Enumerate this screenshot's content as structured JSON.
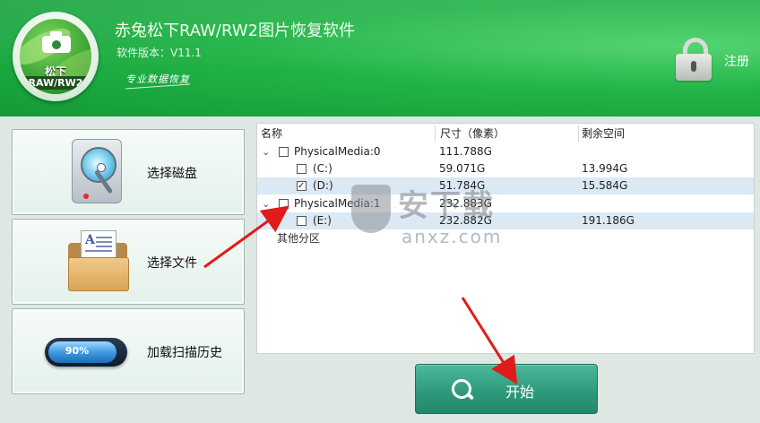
{
  "header": {
    "logo_line1": "松下",
    "logo_line2": "RAW/RW2",
    "title": "赤兔松下RAW/RW2图片恢复软件",
    "version": "软件版本：V11.1",
    "slogan": "专业数据恢复",
    "register_label": "注册"
  },
  "sidebar": {
    "items": [
      {
        "label": "选择磁盘",
        "icon": "disk-icon"
      },
      {
        "label": "选择文件",
        "icon": "folder-icon"
      },
      {
        "label": "加载扫描历史",
        "icon": "progress-icon",
        "progress_text": "90%",
        "progress": 0.9
      }
    ]
  },
  "tree": {
    "columns": [
      "名称",
      "尺寸（像素）",
      "剩余空间"
    ],
    "rows": [
      {
        "name": "PhysicalMedia:0",
        "size": "111.788G",
        "free": "",
        "level": 0,
        "expanded": true,
        "checked": false,
        "selected": false
      },
      {
        "name": "(C:)",
        "size": "59.071G",
        "free": "13.994G",
        "level": 1,
        "checked": false,
        "selected": false
      },
      {
        "name": "(D:)",
        "size": "51.784G",
        "free": "15.584G",
        "level": 1,
        "checked": true,
        "selected": true
      },
      {
        "name": "PhysicalMedia:1",
        "size": "232.883G",
        "free": "",
        "level": 0,
        "expanded": true,
        "checked": false,
        "selected": false
      },
      {
        "name": "(E:)",
        "size": "232.882G",
        "free": "191.186G",
        "level": 1,
        "checked": false,
        "selected": true
      }
    ],
    "other_label": "其他分区"
  },
  "watermark": {
    "big": "安下载",
    "small": "anxz.com"
  },
  "start_button": {
    "label": "开始"
  },
  "colors": {
    "header_green": "#22b448",
    "start_teal": "#2f9a7d",
    "selection": "#dbe9f5",
    "arrow_red": "#e01b1b"
  }
}
